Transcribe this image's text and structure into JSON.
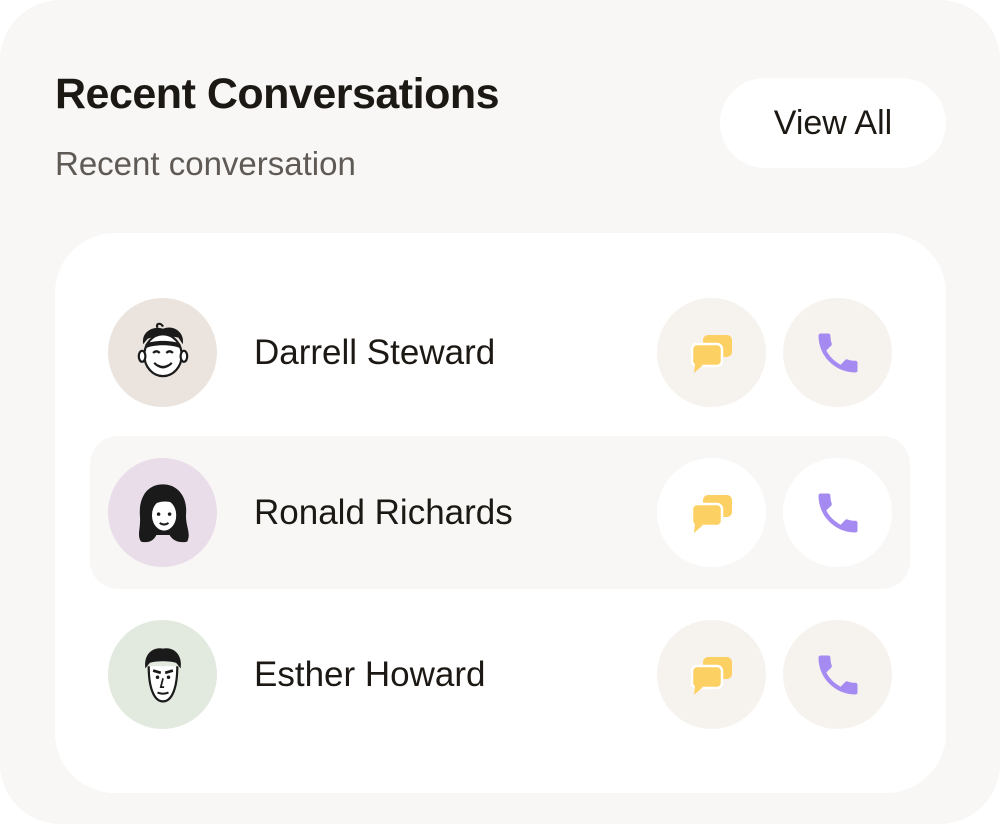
{
  "header": {
    "title": "Recent Conversations",
    "subtitle": "Recent conversation",
    "view_all_label": "View All"
  },
  "conversations": [
    {
      "name": "Darrell Steward",
      "avatar_color": "#ebe4de",
      "avatar_icon": "boy-face-icon",
      "highlighted": false
    },
    {
      "name": "Ronald Richards",
      "avatar_color": "#e9dde9",
      "avatar_icon": "girl-face-icon",
      "highlighted": true
    },
    {
      "name": "Esther Howard",
      "avatar_color": "#e2eadf",
      "avatar_icon": "man-face-icon",
      "highlighted": false
    }
  ],
  "actions": {
    "chat_icon": "chat-bubbles-icon",
    "call_icon": "phone-icon",
    "chat_color": "#fcd062",
    "call_color": "#a58af2"
  }
}
